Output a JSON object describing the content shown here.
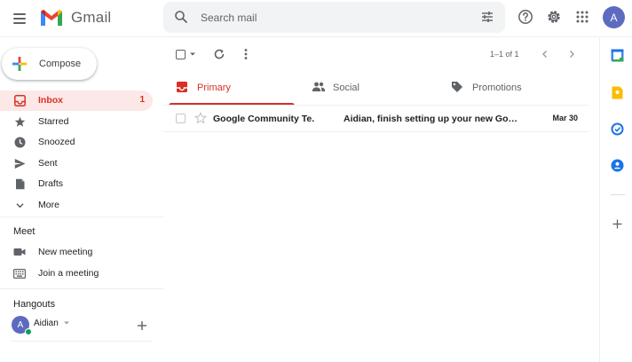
{
  "app": {
    "name": "Gmail"
  },
  "search": {
    "placeholder": "Search mail"
  },
  "user": {
    "initial": "A"
  },
  "compose": {
    "label": "Compose"
  },
  "sidebar": {
    "items": [
      {
        "label": "Inbox",
        "count": "1",
        "icon": "inbox-icon"
      },
      {
        "label": "Starred",
        "icon": "star-icon"
      },
      {
        "label": "Snoozed",
        "icon": "clock-icon"
      },
      {
        "label": "Sent",
        "icon": "send-icon"
      },
      {
        "label": "Drafts",
        "icon": "draft-icon"
      },
      {
        "label": "More",
        "icon": "chevron-down-icon"
      }
    ]
  },
  "meet": {
    "title": "Meet",
    "items": [
      {
        "label": "New meeting",
        "icon": "video-camera-icon"
      },
      {
        "label": "Join a meeting",
        "icon": "keyboard-icon"
      }
    ]
  },
  "hangouts": {
    "title": "Hangouts",
    "user_initial": "A",
    "user_name": "Aidian"
  },
  "toolbar": {
    "page_range": "1–1 of 1"
  },
  "tabs": [
    {
      "label": "Primary",
      "active": true,
      "icon": "inbox-icon"
    },
    {
      "label": "Social",
      "active": false,
      "icon": "people-icon"
    },
    {
      "label": "Promotions",
      "active": false,
      "icon": "tag-icon"
    }
  ],
  "emails": [
    {
      "sender": "Google Community Te.",
      "subject": "Aidian, finish setting up your new Goog…",
      "date": "Mar 30",
      "unread": true
    }
  ],
  "colors": {
    "accent": "#d93025",
    "active_bg": "#fce8e6",
    "avatar": "#5c6bc0",
    "online": "#0f9d58"
  }
}
